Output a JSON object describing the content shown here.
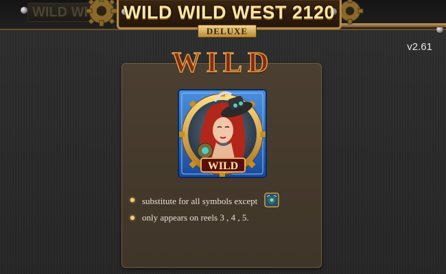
{
  "game": {
    "title": "WILD WILD WEST 2120",
    "edition": "DELUXE",
    "ghost_title": "WILD WI",
    "version": "v2.61"
  },
  "paytable": {
    "heading": "WILD",
    "symbol": {
      "name": "wild-symbol",
      "banner_text": "WILD"
    },
    "rules": [
      "substitute for all symbols except",
      "only appears on reels 3 , 4 , 5."
    ],
    "excepted_symbol_icon": "scatter-symbol-icon"
  },
  "colors": {
    "background": "#2a2a2a",
    "panel": "#4a3f30",
    "title_gold": "#fbe6a4",
    "heading_red": "#8a2a12",
    "frame_gold": "#d8a23a",
    "frame_blue": "#2a6cc0"
  }
}
